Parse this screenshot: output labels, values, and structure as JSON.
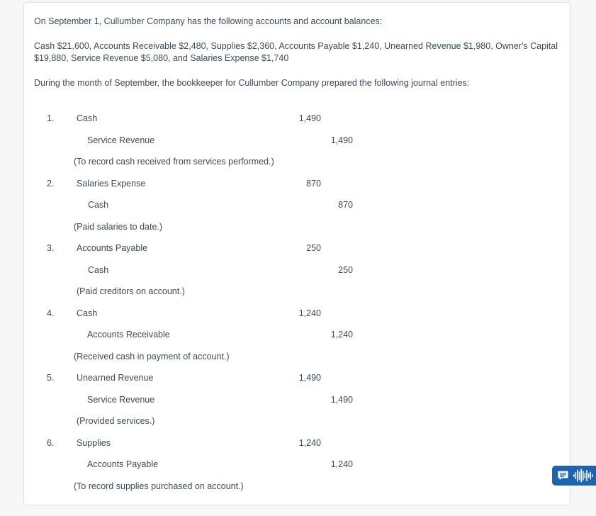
{
  "question": {
    "intro": "On September 1, Cullumber Company has the following accounts and account balances:",
    "balances": "Cash $21,600, Accounts Receivable $2,480, Supplies $2,360, Accounts Payable $1,240, Unearned Revenue $1,980, Owner's Capital $19,880, Service Revenue $5,080, and Salaries Expense $1,740",
    "prompt": "During the month of September, the bookkeeper for Cullumber Company prepared the following journal entries:"
  },
  "journal_entries": [
    {
      "number": "1.",
      "debit_account": "Cash",
      "debit_amount": "1,490",
      "credit_account": "Service Revenue",
      "credit_amount": "1,490",
      "description": "(To record cash received from services performed.)"
    },
    {
      "number": "2.",
      "debit_account": "Salaries Expense",
      "debit_amount": "870",
      "credit_account": "Cash",
      "credit_amount": "870",
      "description": "(Paid salaries to date.)"
    },
    {
      "number": "3.",
      "debit_account": "Accounts Payable",
      "debit_amount": "250",
      "credit_account": "Cash",
      "credit_amount": "250",
      "description": "(Paid creditors on account.)"
    },
    {
      "number": "4.",
      "debit_account": "Cash",
      "debit_amount": "1,240",
      "credit_account": "Accounts Receivable",
      "credit_amount": "1,240",
      "description": "(Received cash in payment of account.)"
    },
    {
      "number": "5.",
      "debit_account": "Unearned Revenue",
      "debit_amount": "1,490",
      "credit_account": "Service Revenue",
      "credit_amount": "1,490",
      "description": "(Provided services.)"
    },
    {
      "number": "6.",
      "debit_account": "Supplies",
      "debit_amount": "1,240",
      "credit_account": "Accounts Payable",
      "credit_amount": "1,240",
      "description": "(To record supplies purchased on account.)"
    }
  ],
  "assistant_widget": {
    "chat_icon": "chat-bubble-icon",
    "audio_icon": "audio-waveform-icon",
    "color": "#1f63ad"
  },
  "colors": {
    "page_background": "#f7f7f7",
    "panel_background": "#ffffff",
    "panel_border": "#e0e1e2",
    "text": "#3d4a58"
  }
}
